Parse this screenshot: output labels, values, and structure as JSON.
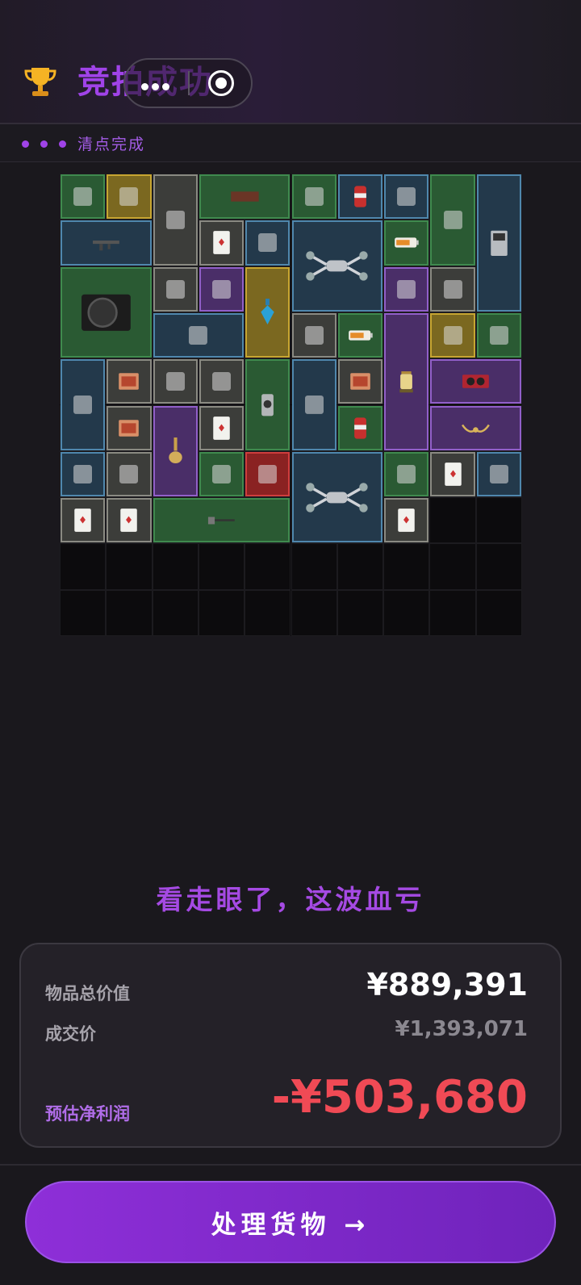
{
  "header": {
    "trophy_icon": "trophy-icon",
    "title": "竞拍成功",
    "capsule": {
      "more_icon": "more-dots-icon",
      "close_icon": "target-icon"
    }
  },
  "subheader": {
    "status": "清点完成"
  },
  "inventory": {
    "columns": 10,
    "rows": 10,
    "items": [
      {
        "name": "power-drill",
        "rarity": "green",
        "icon": "drill-icon"
      },
      {
        "name": "pass-card",
        "rarity": "gold",
        "icon": "card-icon"
      },
      {
        "name": "black-bracket",
        "rarity": "gray",
        "icon": "bracket-icon"
      },
      {
        "name": "wood-plank",
        "rarity": "green",
        "icon": "plank-icon"
      },
      {
        "name": "iv-bag",
        "rarity": "green",
        "icon": "bag-icon"
      },
      {
        "name": "soda-can",
        "rarity": "blue",
        "icon": "can-icon"
      },
      {
        "name": "caliper",
        "rarity": "blue",
        "icon": "caliper-icon"
      },
      {
        "name": "fire-extinguisher-box",
        "rarity": "green",
        "icon": "box-icon"
      },
      {
        "name": "atm-machine",
        "rarity": "blue",
        "icon": "atm-icon"
      },
      {
        "name": "assault-rifle",
        "rarity": "blue",
        "icon": "rifle-icon"
      },
      {
        "name": "playing-card-1",
        "rarity": "gray",
        "icon": "playing-card-icon"
      },
      {
        "name": "coffee-bag",
        "rarity": "blue",
        "icon": "coffee-icon"
      },
      {
        "name": "drone-1",
        "rarity": "blue",
        "icon": "drone-icon"
      },
      {
        "name": "battery-1",
        "rarity": "green",
        "icon": "battery-icon"
      },
      {
        "name": "psu",
        "rarity": "green",
        "icon": "psu-icon"
      },
      {
        "name": "mouse",
        "rarity": "gray",
        "icon": "mouse-icon"
      },
      {
        "name": "pen",
        "rarity": "purple",
        "icon": "pen-icon"
      },
      {
        "name": "perfume-bottle",
        "rarity": "gold",
        "icon": "perfume-icon"
      },
      {
        "name": "cassette",
        "rarity": "purple",
        "icon": "cassette-icon"
      },
      {
        "name": "shot-glass",
        "rarity": "gray",
        "icon": "glass-icon"
      },
      {
        "name": "smoking-pipe",
        "rarity": "blue",
        "icon": "pipe-icon"
      },
      {
        "name": "cpu-cooler",
        "rarity": "gray",
        "icon": "cooler-icon"
      },
      {
        "name": "battery-2",
        "rarity": "green",
        "icon": "battery-icon"
      },
      {
        "name": "lantern",
        "rarity": "purple",
        "icon": "lantern-icon"
      },
      {
        "name": "crossed-swords",
        "rarity": "gold",
        "icon": "swords-icon"
      },
      {
        "name": "pocket-watch",
        "rarity": "green",
        "icon": "watch-icon"
      },
      {
        "name": "stethoscope",
        "rarity": "blue",
        "icon": "stethoscope-icon"
      },
      {
        "name": "snack-pack-1",
        "rarity": "gray",
        "icon": "snack-icon"
      },
      {
        "name": "documents",
        "rarity": "gray",
        "icon": "paper-icon"
      },
      {
        "name": "duct-tape",
        "rarity": "gray",
        "icon": "tape-icon"
      },
      {
        "name": "spray-can",
        "rarity": "green",
        "icon": "spray-icon"
      },
      {
        "name": "certificate",
        "rarity": "blue",
        "icon": "certificate-icon"
      },
      {
        "name": "snack-pack-2",
        "rarity": "gray",
        "icon": "snack-icon"
      },
      {
        "name": "graphics-card",
        "rarity": "purple",
        "icon": "gpu-icon"
      },
      {
        "name": "snack-pack-3",
        "rarity": "gray",
        "icon": "snack-icon"
      },
      {
        "name": "hookah",
        "rarity": "purple",
        "icon": "hookah-icon"
      },
      {
        "name": "playing-card-2",
        "rarity": "gray",
        "icon": "playing-card-icon"
      },
      {
        "name": "energy-can",
        "rarity": "green",
        "icon": "can-icon"
      },
      {
        "name": "horned-crown",
        "rarity": "purple",
        "icon": "crown-icon"
      },
      {
        "name": "cctv-camera",
        "rarity": "blue",
        "icon": "camera-icon"
      },
      {
        "name": "tea-box",
        "rarity": "gray",
        "icon": "box-icon"
      },
      {
        "name": "power-strip",
        "rarity": "green",
        "icon": "strip-icon"
      },
      {
        "name": "tin-box",
        "rarity": "red",
        "icon": "tin-icon"
      },
      {
        "name": "drone-2",
        "rarity": "blue",
        "icon": "drone-icon"
      },
      {
        "name": "screwdriver",
        "rarity": "green",
        "icon": "screwdriver-icon"
      },
      {
        "name": "playing-card-3",
        "rarity": "gray",
        "icon": "playing-card-icon"
      },
      {
        "name": "tea-tin",
        "rarity": "blue",
        "icon": "tin-icon"
      },
      {
        "name": "portrait-card",
        "rarity": "gray",
        "icon": "playing-card-icon"
      },
      {
        "name": "playing-card-4",
        "rarity": "gray",
        "icon": "playing-card-icon"
      },
      {
        "name": "sledgehammer",
        "rarity": "green",
        "icon": "hammer-icon"
      },
      {
        "name": "playing-card-5",
        "rarity": "gray",
        "icon": "playing-card-icon"
      }
    ]
  },
  "verdict": "看走眼了，这波血亏",
  "summary": {
    "total_label": "物品总价值",
    "total_value": "¥889,391",
    "deal_label": "成交价",
    "deal_value": "¥1,393,071",
    "profit_label": "预估净利润",
    "profit_value": "-¥503,680"
  },
  "cta": {
    "label": "处理货物 →"
  },
  "colors": {
    "accent": "#a043e8",
    "loss": "#f04a55",
    "background": "#1a181d"
  }
}
